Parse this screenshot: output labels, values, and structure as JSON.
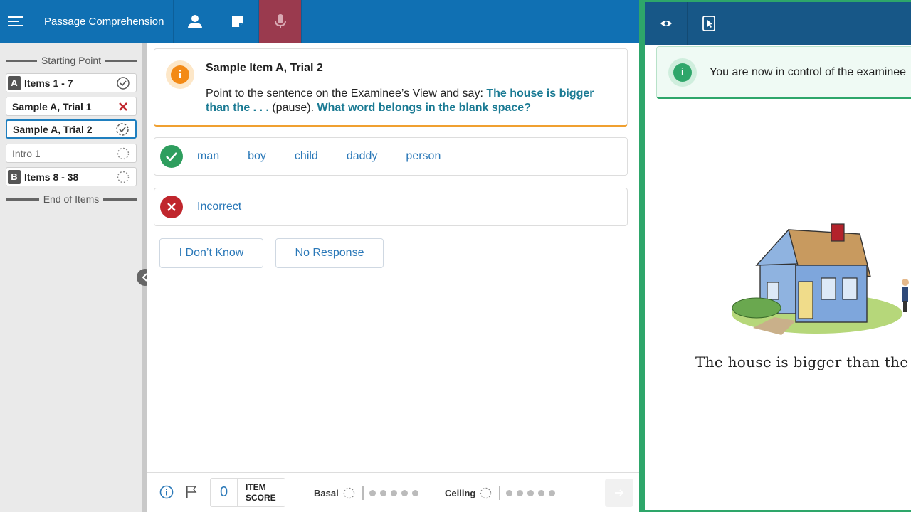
{
  "header": {
    "title": "Passage Comprehension",
    "menu_icon": "menu-icon",
    "buttons": [
      "examinee-icon",
      "notes-icon",
      "microphone-icon"
    ],
    "color": "#1070b3",
    "active_color": "#9a3a4e"
  },
  "sidebar": {
    "starting_point": "Starting Point",
    "end_of_items": "End of Items",
    "items": [
      {
        "letter": "A",
        "label": "Items 1 - 7",
        "status": "complete"
      },
      {
        "label": "Sample A, Trial 1",
        "status": "incorrect"
      },
      {
        "label": "Sample A, Trial 2",
        "status": "in-progress"
      },
      {
        "label": "Intro 1",
        "status": "pending"
      },
      {
        "letter": "B",
        "label": "Items 8 - 38",
        "status": "pending"
      }
    ]
  },
  "instruction": {
    "title": "Sample Item A, Trial 2",
    "text_prefix": "Point to the sentence on the Examinee’s View and say: ",
    "text_emph_1": "The house is bigger than the . . .",
    "text_mid": " (pause). ",
    "text_emph_2": "What word belongs in the blank space?"
  },
  "correct_answers": [
    "man",
    "boy",
    "child",
    "daddy",
    "person"
  ],
  "incorrect_label": "Incorrect",
  "actions": {
    "dont_know": "I Don’t Know",
    "no_response": "No Response"
  },
  "footer": {
    "item_score": "0",
    "item_score_label_1": "ITEM",
    "item_score_label_2": "SCORE",
    "basal": "Basal",
    "ceiling": "Ceiling"
  },
  "examinee_view": {
    "notice": "You are now in control of the examinee",
    "sentence": "The house is bigger than the __",
    "accent": "#2ea66a"
  }
}
